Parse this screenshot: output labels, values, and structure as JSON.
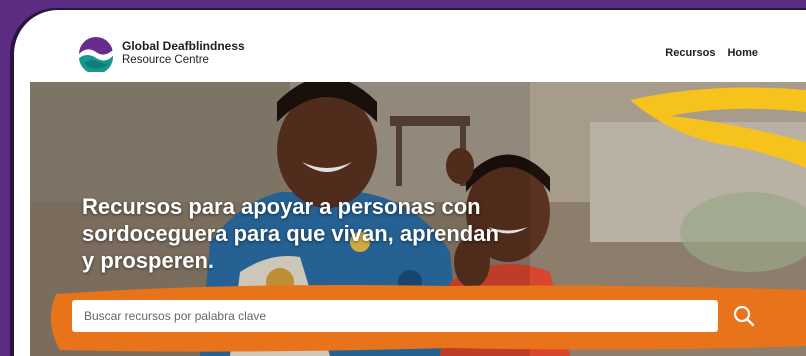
{
  "brand": {
    "name_line1": "Global Deafblindness",
    "name_line2": "Resource Centre"
  },
  "nav": {
    "items": [
      {
        "label": "Recursos"
      },
      {
        "label": "Home"
      }
    ]
  },
  "hero": {
    "title": "Recursos para apoyar a personas con sordoceguera para que vivan, aprendan y prosperen."
  },
  "search": {
    "placeholder": "Buscar recursos por palabra clave"
  },
  "colors": {
    "background_purple": "#5a2d82",
    "accent_orange": "#e8731a",
    "accent_yellow": "#f6c21c",
    "logo_teal": "#15998f",
    "logo_purple": "#6a2c8a"
  }
}
